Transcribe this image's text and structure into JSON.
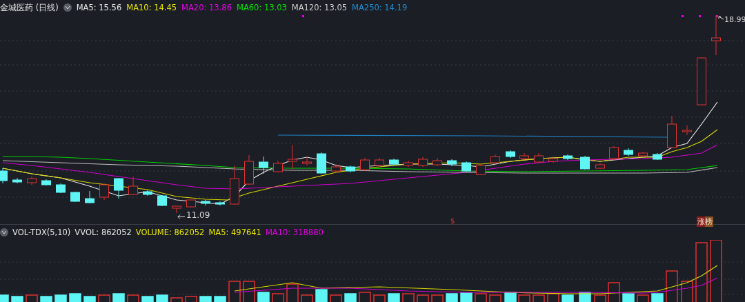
{
  "price_panel": {
    "title": "金城医药 (日线)",
    "indicators": [
      {
        "label": "MA5: 15.56",
        "color": "#e6e6e6"
      },
      {
        "label": "MA10: 14.45",
        "color": "#e8e800"
      },
      {
        "label": "MA20: 13.86",
        "color": "#e600e6"
      },
      {
        "label": "MA60: 13.03",
        "color": "#00e600"
      },
      {
        "label": "MA120: 13.05",
        "color": "#cfcfcf"
      },
      {
        "label": "MA250: 14.19",
        "color": "#1f8fd6"
      }
    ],
    "high_label": "18.99",
    "low_label": "11.09",
    "marker": "$",
    "badge": "涨榜"
  },
  "volume_panel": {
    "indicators": [
      {
        "label": "VOL-TDX(5,10)",
        "color": "#e6e6e6"
      },
      {
        "label": "VVOL: 862052",
        "color": "#e6e6e6"
      },
      {
        "label": "VOLUME: 862052",
        "color": "#e8e800"
      },
      {
        "label": "MA5: 497641",
        "color": "#e8e800"
      },
      {
        "label": "MA10: 318880",
        "color": "#e600e6"
      }
    ]
  }
}
